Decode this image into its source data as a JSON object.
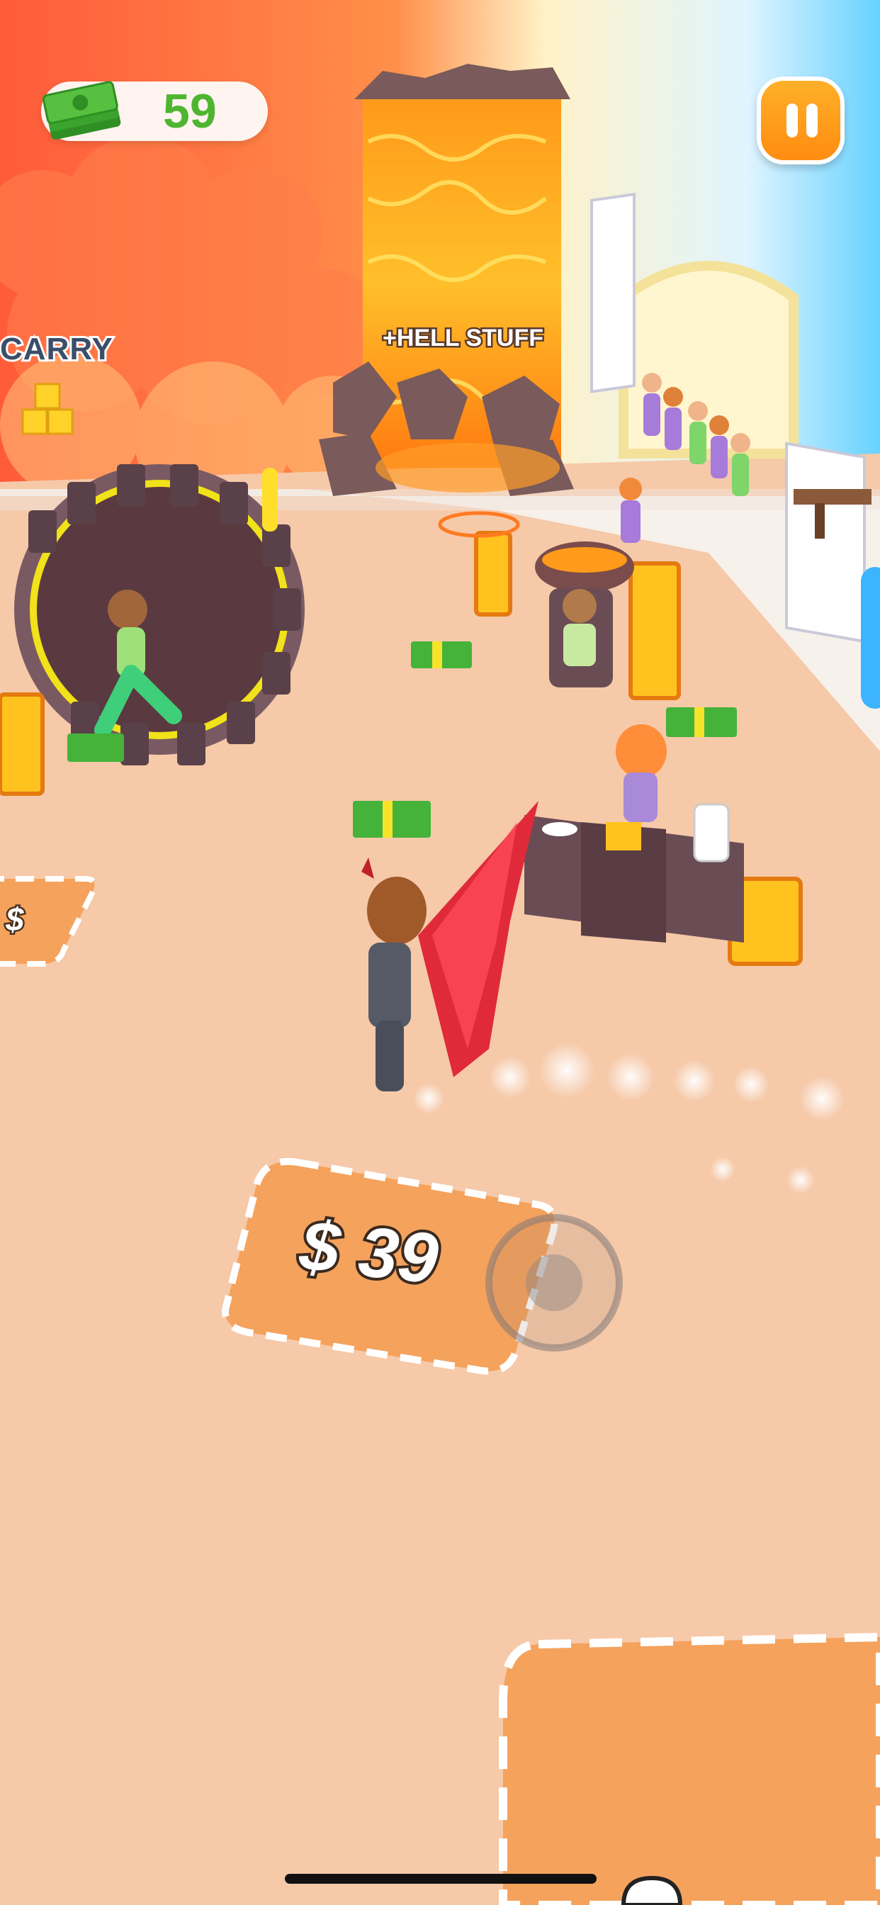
{
  "hud": {
    "money_value": "59",
    "money_icon": "cash-stack-icon",
    "pause_icon": "pause-icon"
  },
  "world": {
    "carry_label": "CARRY",
    "hell_stuff_label": "+HELL STUFF",
    "unlock_price_main": "$ 39",
    "unlock_price_left": "$"
  },
  "colors": {
    "money_green": "#4fb531",
    "pause_orange": "#ff9a18",
    "floor": "#f6c9a9",
    "unlock_pad": "#f5a25c"
  }
}
